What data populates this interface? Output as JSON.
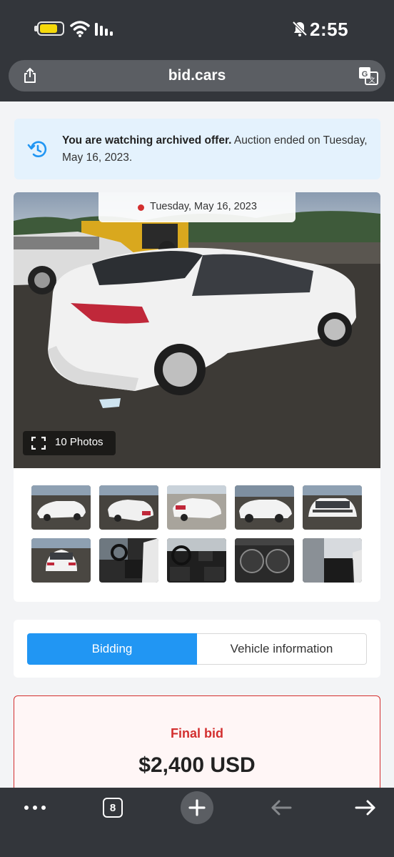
{
  "status_bar": {
    "time": "2:55",
    "icons": [
      "battery-icon",
      "wifi-icon",
      "signal-icon",
      "bell-muted-icon"
    ]
  },
  "browser": {
    "url": "bid.cars",
    "tab_count": "8"
  },
  "archive_notice": {
    "bold_text": "You are watching archived offer.",
    "text": " Auction ended on Tuesday, May 16, 2023.",
    "color": "#e4f2fd"
  },
  "gallery": {
    "auction_date": "Tuesday, May 16, 2023",
    "photos_label": "10 Photos"
  },
  "tabs": {
    "bidding": "Bidding",
    "vehicle_information": "Vehicle information",
    "active": "Bidding",
    "accent": "#2196f3"
  },
  "final_bid": {
    "label": "Final bid",
    "amount": "$2,400 USD",
    "accent": "#d32f2f"
  }
}
